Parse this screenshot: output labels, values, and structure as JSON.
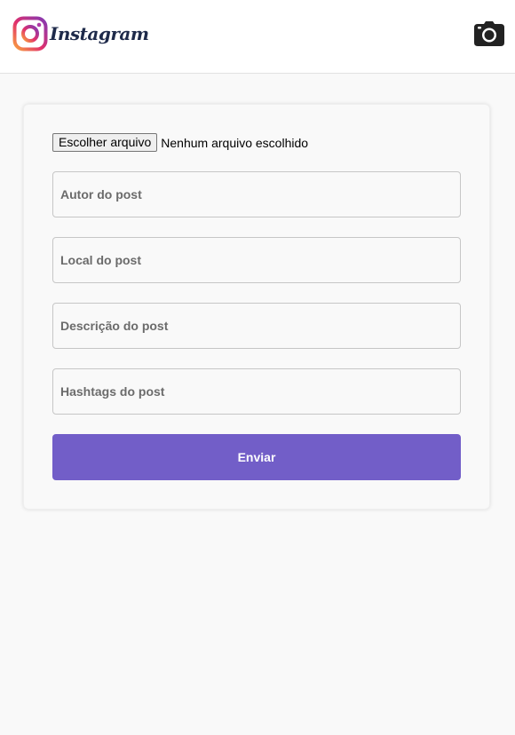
{
  "header": {
    "logo_icon": "instagram-logo-icon",
    "logo_text": "Instagram",
    "camera_icon": "camera-icon"
  },
  "form": {
    "file_button_label": "Escolher arquivo",
    "file_status": "Nenhum arquivo escolhido",
    "author_placeholder": "Autor do post",
    "location_placeholder": "Local do post",
    "description_placeholder": "Descrição do post",
    "hashtags_placeholder": "Hashtags do post",
    "submit_label": "Enviar"
  },
  "colors": {
    "page_background": "#f9f9f9",
    "submit_button": "#725ec8",
    "logo_text": "#1e2a4a"
  }
}
